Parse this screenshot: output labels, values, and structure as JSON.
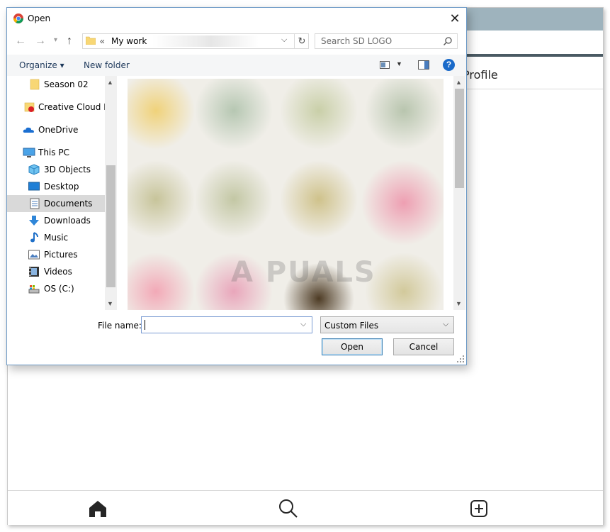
{
  "background_page": {
    "title": "Profile",
    "bottom_nav": [
      "home-icon",
      "search-icon",
      "add-icon"
    ]
  },
  "dialog": {
    "title": "Open",
    "close_label": "✕",
    "address": {
      "chevron": "«",
      "path": "My work"
    },
    "search": {
      "placeholder": "Search SD LOGO"
    },
    "toolbar": {
      "organize": "Organize ▾",
      "new_folder": "New folder",
      "help": "?"
    },
    "sidebar": [
      {
        "label": "Season 02",
        "icon": "folder-icon"
      },
      {
        "label": "Creative Cloud Fil",
        "icon": "creative-cloud-icon"
      },
      {
        "label": "OneDrive",
        "icon": "onedrive-icon"
      },
      {
        "label": "This PC",
        "icon": "this-pc-icon"
      },
      {
        "label": "3D Objects",
        "icon": "3d-objects-icon"
      },
      {
        "label": "Desktop",
        "icon": "desktop-icon"
      },
      {
        "label": "Documents",
        "icon": "documents-icon",
        "selected": true
      },
      {
        "label": "Downloads",
        "icon": "downloads-icon"
      },
      {
        "label": "Music",
        "icon": "music-icon"
      },
      {
        "label": "Pictures",
        "icon": "pictures-icon"
      },
      {
        "label": "Videos",
        "icon": "videos-icon"
      },
      {
        "label": "OS (C:)",
        "icon": "drive-icon"
      }
    ],
    "watermark": "A  PUALS",
    "file_name_label": "File name:",
    "file_name_value": "",
    "file_type": "Custom Files",
    "open_button": "Open",
    "cancel_button": "Cancel"
  },
  "colors": {
    "accent": "#1a6ac9",
    "topbar": "#9eb3bd",
    "selection": "#d9d9d9"
  }
}
